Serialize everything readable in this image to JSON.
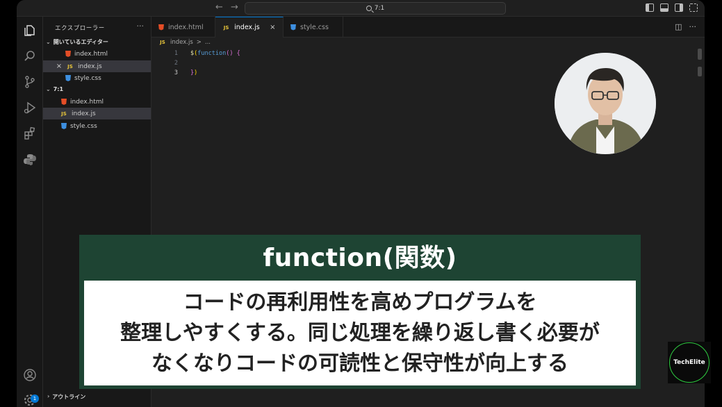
{
  "titlebar": {
    "back": "←",
    "forward": "→",
    "search_text": "7:1"
  },
  "sidebar": {
    "title": "エクスプローラー",
    "more": "···",
    "open_editors_label": "開いているエディター",
    "open_editors": [
      {
        "name": "index.html",
        "type": "html"
      },
      {
        "name": "index.js",
        "type": "js",
        "close": "×"
      },
      {
        "name": "style.css",
        "type": "css"
      }
    ],
    "folder_label": "7:1",
    "files": [
      {
        "name": "index.html",
        "type": "html"
      },
      {
        "name": "index.js",
        "type": "js"
      },
      {
        "name": "style.css",
        "type": "css"
      }
    ],
    "outline_label": "アウトライン"
  },
  "tabs": [
    {
      "label": "index.html",
      "type": "html"
    },
    {
      "label": "index.js",
      "type": "js",
      "close": "×"
    },
    {
      "label": "style.css",
      "type": "css"
    }
  ],
  "tab_actions": {
    "split": "◫",
    "more": "···"
  },
  "breadcrumb": {
    "file": "index.js",
    "sep": ">",
    "rest": "..."
  },
  "editor": {
    "lines": [
      {
        "num": "1"
      },
      {
        "num": "2"
      },
      {
        "num": "3"
      }
    ],
    "code1_dollar": "$",
    "code1_open": "(",
    "code1_kw": "function",
    "code1_args": "()",
    "code1_brace": " {",
    "code3_close1": "}",
    "code3_close2": ")"
  },
  "file_icon_labels": {
    "js": "JS"
  },
  "caption": {
    "title": "function(関数)",
    "body_lines": [
      "コードの再利用性を高めプログラムを",
      "整理しやすくする。同じ処理を繰り返し書く必要が",
      "なくなりコードの可読性と保守性が向上する"
    ]
  },
  "badge": "1",
  "logo": "TechElite",
  "colors": {
    "caption_bg": "#1e4433",
    "logo_ring": "#2ecc40",
    "accent": "#0078d4"
  }
}
